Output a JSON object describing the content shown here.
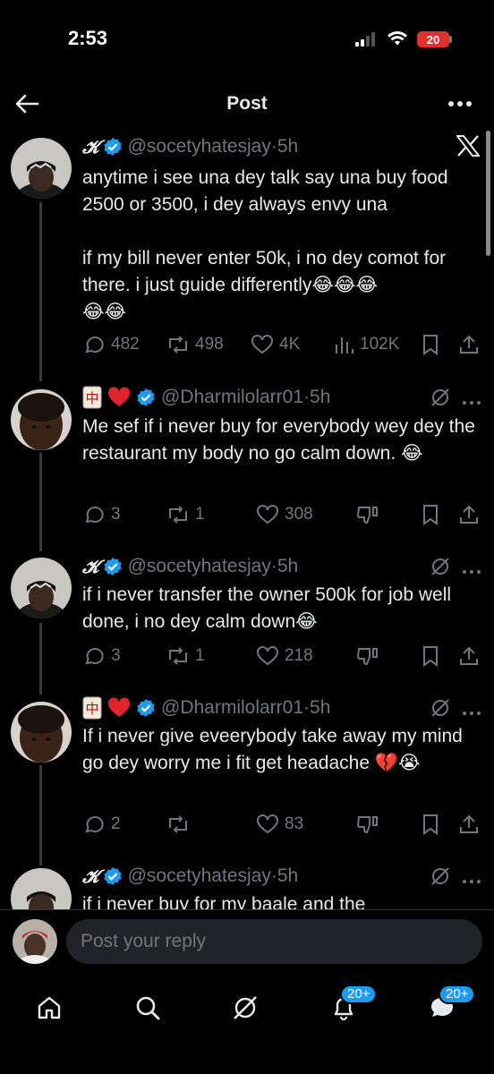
{
  "status_bar": {
    "time": "2:53",
    "battery": "20"
  },
  "header": {
    "title": "Post"
  },
  "posts": [
    {
      "display_name": "𝓚",
      "handle": "@socetyhatesjay",
      "separator": "·",
      "time": "5h",
      "body_lines": [
        "anytime i see una dey talk say una buy food 2500 or 3500, i dey always envy una",
        "",
        "if my bill never enter 50k, i no dey comot for there. i just guide differently😂😂😂",
        "😂😂"
      ],
      "replies": "482",
      "reposts": "498",
      "likes": "4K",
      "views": "102K"
    },
    {
      "name_emojis": [
        "🀄",
        "❤️"
      ],
      "handle": "@Dharmilolarr01",
      "separator": "·",
      "time": "5h",
      "body": "Me sef if i never buy for everybody wey dey the restaurant my body no go calm down. 😂",
      "replies": "3",
      "reposts": "1",
      "likes": "308"
    },
    {
      "display_name": "𝓚",
      "handle": "@socetyhatesjay",
      "separator": "·",
      "time": "5h",
      "body": "if i never transfer the owner 500k for job well done, i no dey calm down😂",
      "replies": "3",
      "reposts": "1",
      "likes": "218"
    },
    {
      "name_emojis": [
        "🀄",
        "❤️"
      ],
      "handle": "@Dharmilolarr01",
      "separator": "·",
      "time": "5h",
      "body": "If i never give eveerybody take away my mind go dey worry me i fit get headache 💔😭",
      "replies": "2",
      "reposts": "",
      "likes": "83"
    },
    {
      "display_name": "𝓚",
      "handle": "@socetyhatesjay",
      "separator": "·",
      "time": "5h",
      "body": "if i never buy for my baale and the"
    }
  ],
  "reply_bar": {
    "placeholder": "Post your reply"
  },
  "nav": {
    "notifications_badge": "20+",
    "messages_badge": "20+"
  },
  "colors": {
    "background": "#000000",
    "text": "#e7e9ea",
    "muted": "#71767b",
    "accent": "#1d9bf0"
  }
}
